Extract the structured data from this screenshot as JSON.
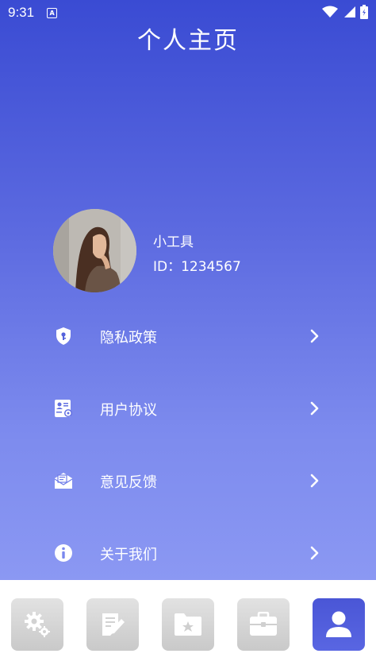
{
  "status_bar": {
    "time": "9:31",
    "a_label": "A",
    "icons": [
      "wifi-icon",
      "signal-icon",
      "battery-icon"
    ]
  },
  "header": {
    "title": "个人主页"
  },
  "profile": {
    "name": "小工具",
    "id_text": "ID：1234567"
  },
  "menu": {
    "items": [
      {
        "label": "隐私政策",
        "icon": "shield-key-icon"
      },
      {
        "label": "用户协议",
        "icon": "user-document-icon"
      },
      {
        "label": "意见反馈",
        "icon": "mail-edit-icon"
      },
      {
        "label": "关于我们",
        "icon": "info-icon"
      }
    ]
  },
  "tabbar": {
    "tabs": [
      {
        "icon": "gears-icon",
        "active": false
      },
      {
        "icon": "notepad-icon",
        "active": false
      },
      {
        "icon": "star-folder-icon",
        "active": false
      },
      {
        "icon": "briefcase-icon",
        "active": false
      },
      {
        "icon": "person-icon",
        "active": true
      }
    ]
  },
  "colors": {
    "gradient_top": "#3a4bd3",
    "gradient_bottom": "#8b98f3",
    "active_tab": "#4a56d6",
    "inactive_tab": "#d4d4d4"
  }
}
